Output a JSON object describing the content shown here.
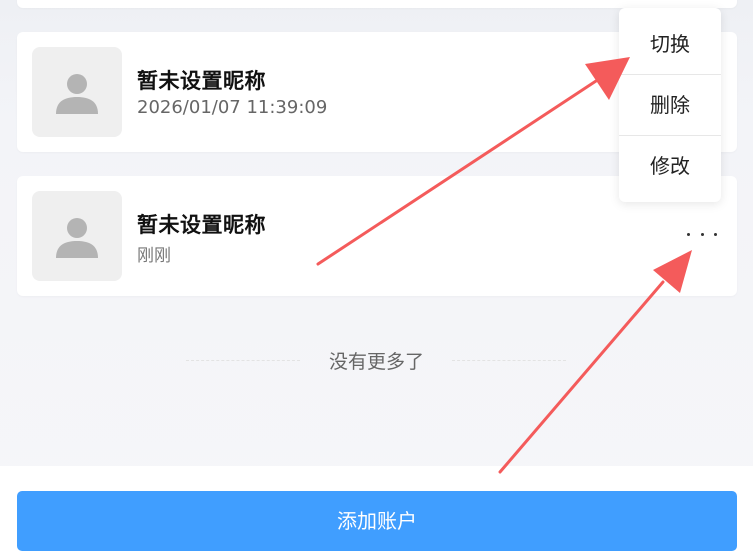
{
  "accounts": [
    {
      "name": "暂未设置昵称",
      "time": "2026/01/07 11:39:09"
    },
    {
      "name": "暂未设置昵称",
      "time": "刚刚"
    }
  ],
  "popup_menu": {
    "switch": "切换",
    "delete": "删除",
    "edit": "修改"
  },
  "list_end_text": "没有更多了",
  "footer": {
    "add_button": "添加账户"
  },
  "icons": {
    "avatar": "user-silhouette-icon",
    "more": "more-dots-icon",
    "arrow": "arrow-icon"
  },
  "colors": {
    "primary": "#409eff",
    "annotation_arrow": "#f45b5b",
    "background": "#f3f4f8"
  }
}
